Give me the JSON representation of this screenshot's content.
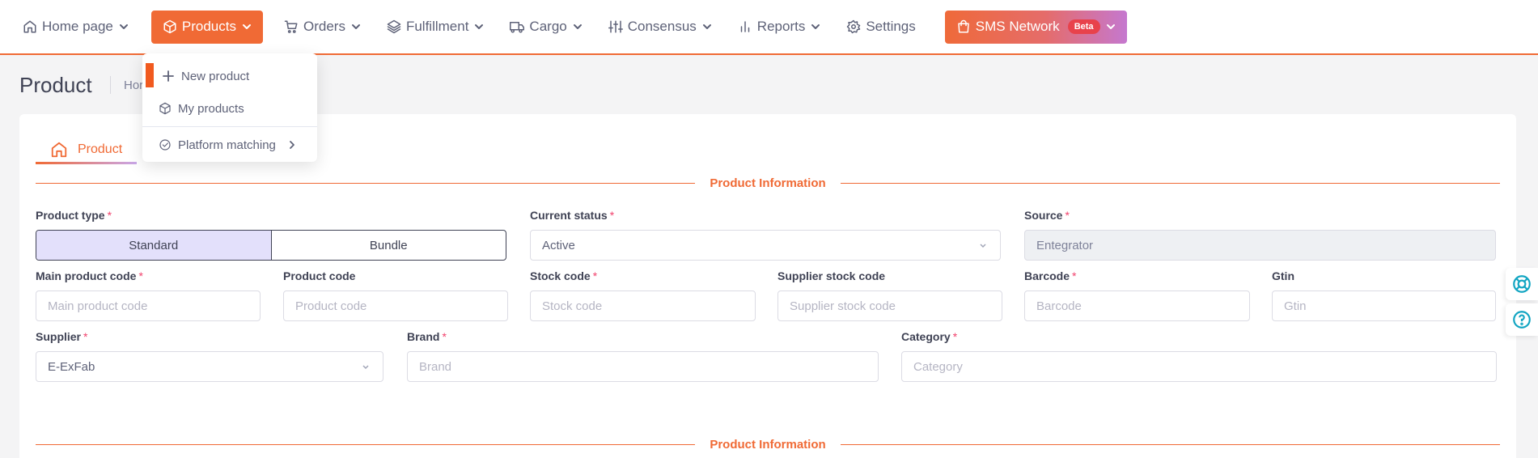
{
  "nav": {
    "home": "Home page",
    "products": "Products",
    "orders": "Orders",
    "fulfillment": "Fulfillment",
    "cargo": "Cargo",
    "consensus": "Consensus",
    "reports": "Reports",
    "settings": "Settings",
    "sms_network": "SMS Network",
    "beta_badge": "Beta"
  },
  "products_menu": {
    "items": [
      "New product",
      "My products",
      "Platform matching"
    ]
  },
  "page": {
    "title": "Product",
    "breadcrumb": [
      "Hor",
      "",
      "uct"
    ]
  },
  "tabs": [
    "Product"
  ],
  "sections": [
    "Product Information",
    "Product Information"
  ],
  "form": {
    "product_type": {
      "label": "Product type",
      "options": [
        "Standard",
        "Bundle"
      ],
      "selected": "Standard"
    },
    "current_status": {
      "label": "Current status",
      "value": "Active"
    },
    "source": {
      "label": "Source",
      "value": "Entegrator"
    },
    "main_product_code": {
      "label": "Main product code",
      "placeholder": "Main product code"
    },
    "product_code": {
      "label": "Product code",
      "placeholder": "Product code"
    },
    "stock_code": {
      "label": "Stock code",
      "placeholder": "Stock code"
    },
    "supplier_stock_code": {
      "label": "Supplier stock code",
      "placeholder": "Supplier stock code"
    },
    "barcode": {
      "label": "Barcode",
      "placeholder": "Barcode"
    },
    "gtin": {
      "label": "Gtin",
      "placeholder": "Gtin"
    },
    "supplier": {
      "label": "Supplier",
      "value": "E-ExFab"
    },
    "brand": {
      "label": "Brand",
      "placeholder": "Brand"
    },
    "category": {
      "label": "Category",
      "placeholder": "Category"
    },
    "required_mark": "*"
  },
  "colors": {
    "accent": "#f06a35",
    "required": "#f1416c",
    "segment_selected": "#e3e0fb",
    "help_icon": "#12a5c2"
  }
}
